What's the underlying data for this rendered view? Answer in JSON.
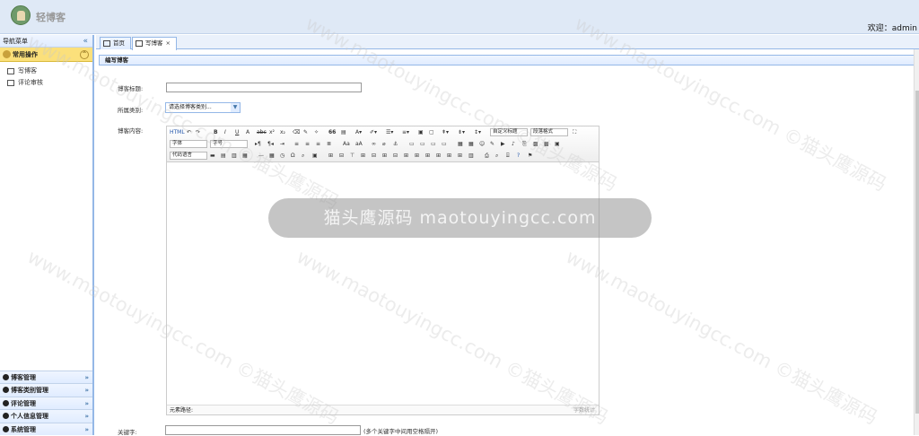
{
  "app": {
    "title": "轻博客",
    "welcome": "欢迎：admin"
  },
  "sidebar": {
    "nav_title": "导航菜单",
    "collapse_icon": "«",
    "common": {
      "label": "常用操作",
      "items": [
        {
          "label": "写博客",
          "icon": "edit-icon"
        },
        {
          "label": "评论审核",
          "icon": "comment-review-icon"
        }
      ]
    },
    "sections": [
      {
        "label": "博客管理",
        "icon": "blog-icon"
      },
      {
        "label": "博客类别管理",
        "icon": "category-icon"
      },
      {
        "label": "评论管理",
        "icon": "comment-icon"
      },
      {
        "label": "个人信息管理",
        "icon": "user-icon"
      },
      {
        "label": "系统管理",
        "icon": "system-icon"
      }
    ],
    "expand_icon": "»"
  },
  "tabs": [
    {
      "label": "首页",
      "icon": "home-icon"
    },
    {
      "label": "写博客",
      "icon": "edit-icon",
      "close": "×"
    }
  ],
  "form": {
    "panel_title": "编写博客",
    "title_label": "博客标题:",
    "category_label": "所属类别:",
    "category_placeholder": "请选择博客类别...",
    "content_label": "博客内容:",
    "keyword_label": "关键字:",
    "keyword_hint": "(多个关键字中间用空格隔开)"
  },
  "editor": {
    "toolbar": {
      "custom_title": "自定义标题",
      "paragraph": "段落格式",
      "font_family": "字体",
      "font_size": "字号",
      "code_lang": "代码语言",
      "source": "HTML"
    },
    "status_path": "元素路径:",
    "word_count": "字数统计"
  },
  "watermark": {
    "band": "猫头鹰源码 maotouyingcc.com",
    "diagonal": "www.maotouyingcc.com ©猫头鹰源码"
  },
  "colors": {
    "header_bg": "#dfe9f6",
    "accent_blue": "#95b8e7",
    "active_accordion": "#fbe07b"
  }
}
